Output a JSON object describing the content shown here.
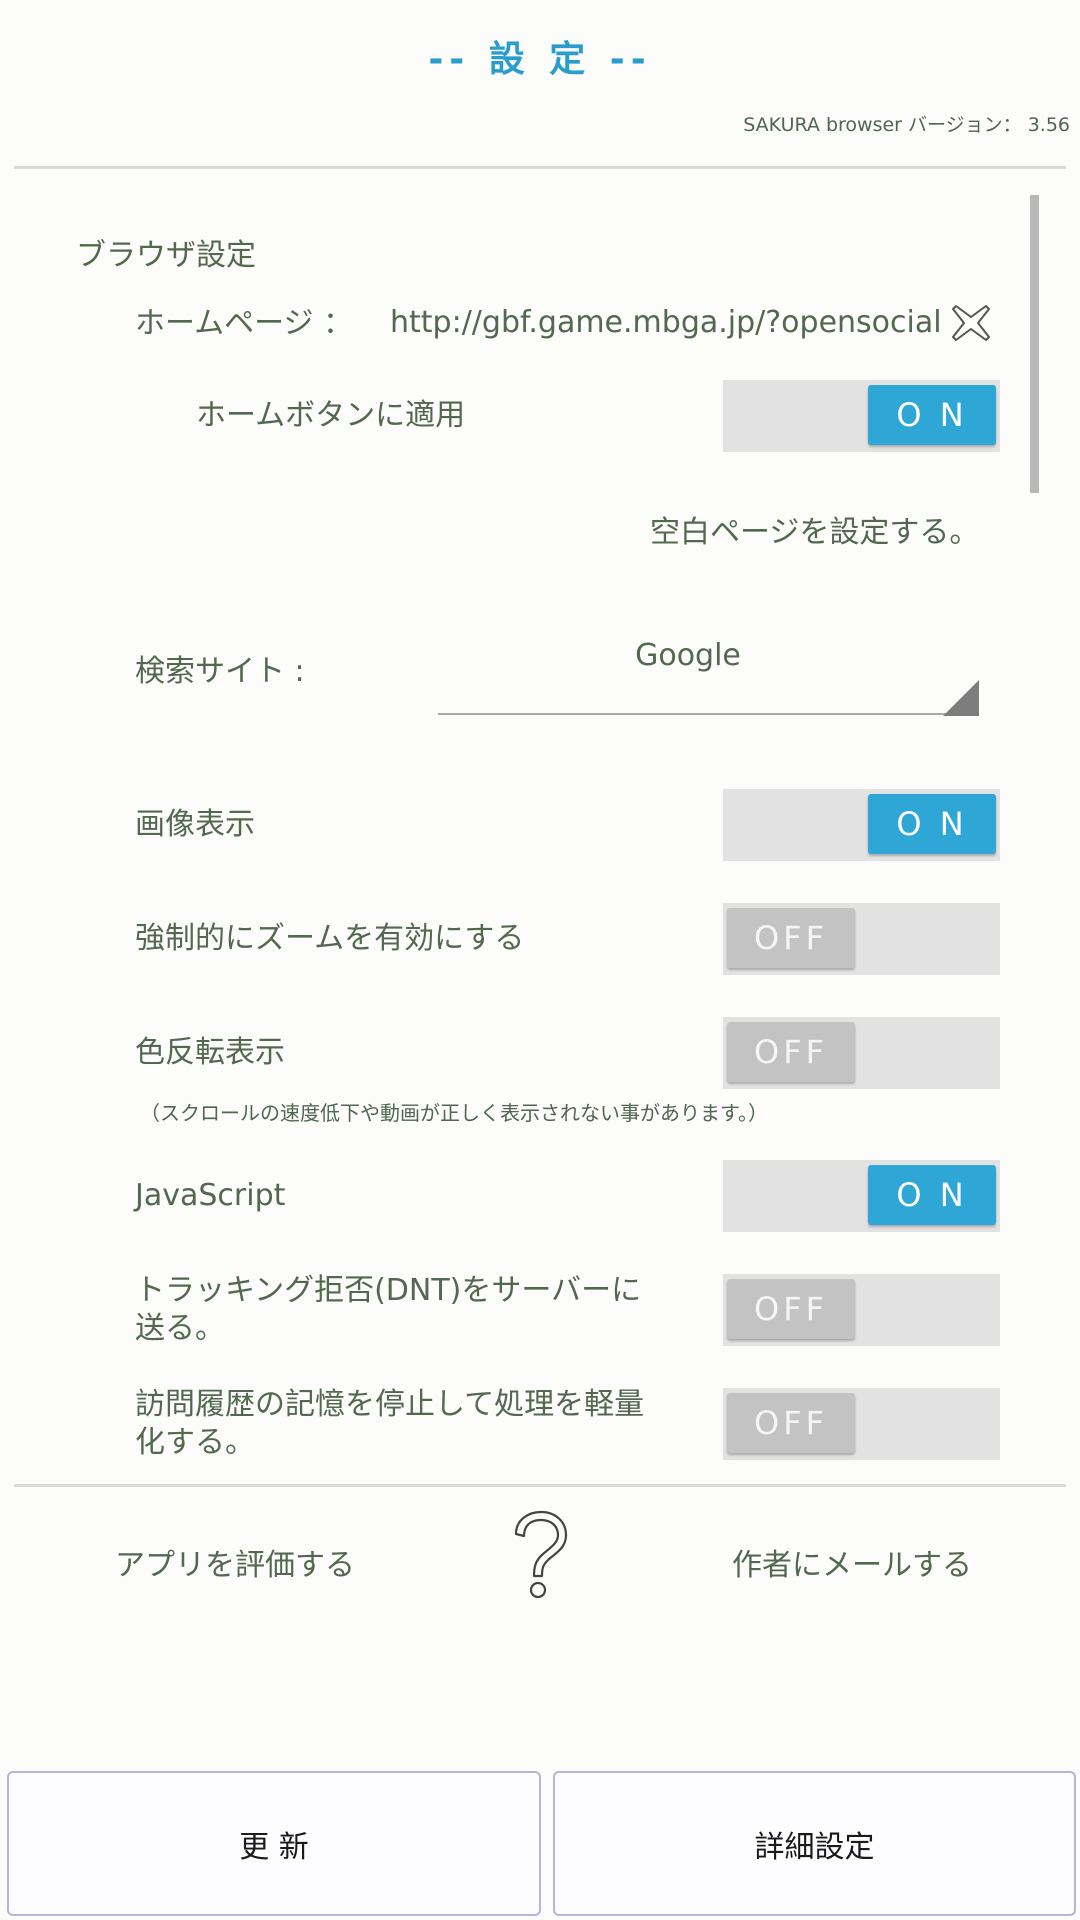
{
  "header": {
    "title": "-- 設 定 --",
    "version": "SAKURA browser バージョン： 3.56"
  },
  "browser_settings": {
    "section_title": "ブラウザ設定",
    "homepage_label": "ホームページ ：",
    "homepage_url": "http://gbf.game.mbga.jp/?opensocial_vi",
    "apply_home_label": "ホームボタンに適用",
    "blank_page_link": "空白ページを設定する。",
    "search_label": "検索サイト :",
    "search_value": "Google",
    "image_label": "画像表示",
    "zoom_label": "強制的にズームを有効にする",
    "invert_label": "色反転表示",
    "invert_note": "（スクロールの速度低下や動画が正しく表示されない事があります。）",
    "js_label": "JavaScript",
    "dnt_label_1": "トラッキング拒否(DNT)をサーバーに",
    "dnt_label_2": "送る。",
    "history_label_1": "訪問履歴の記憶を停止して処理を軽量",
    "history_label_2": "化する。"
  },
  "toggles": {
    "on_text": "O N",
    "off_text": "OFF",
    "apply_home": "on",
    "image": "on",
    "zoom": "off",
    "invert": "off",
    "javascript": "on",
    "dnt": "off",
    "history": "off"
  },
  "footer": {
    "rate_app": "アプリを評価する",
    "help_icon": "question-mark-icon",
    "mail_author": "作者にメールする",
    "update_button": "更 新",
    "detail_button": "詳細設定"
  },
  "colors": {
    "accent": "#2b9dcc",
    "toggle_on": "#2ea6d6",
    "toggle_off": "#c3c3c3",
    "text": "#52694f"
  }
}
